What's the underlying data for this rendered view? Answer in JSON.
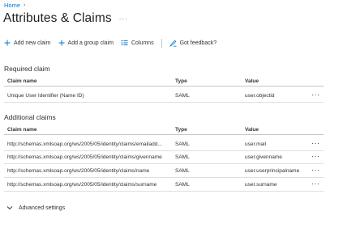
{
  "breadcrumb": {
    "home": "Home",
    "separator": "›"
  },
  "header": {
    "title": "Attributes & Claims",
    "more": "···"
  },
  "toolbar": {
    "add_new_claim": "Add new claim",
    "add_group_claim": "Add a group claim",
    "columns": "Columns",
    "feedback": "Got feedback?"
  },
  "required": {
    "heading": "Required claim",
    "columns": {
      "name": "Claim name",
      "type": "Type",
      "value": "Value"
    },
    "rows": [
      {
        "name": "Unique User Identifier (Name ID)",
        "type": "SAML",
        "value": "user.objectid",
        "more": "···"
      }
    ]
  },
  "additional": {
    "heading": "Additional claims",
    "columns": {
      "name": "Claim name",
      "type": "Type",
      "value": "Value"
    },
    "rows": [
      {
        "name": "http://schemas.xmlsoap.org/ws/2005/05/identity/claims/emailadd...",
        "type": "SAML",
        "value": "user.mail",
        "more": "···"
      },
      {
        "name": "http://schemas.xmlsoap.org/ws/2005/05/identity/claims/givenname",
        "type": "SAML",
        "value": "user.givenname",
        "more": "···"
      },
      {
        "name": "http://schemas.xmlsoap.org/ws/2005/05/identity/claims/name",
        "type": "SAML",
        "value": "user.userprincipalname",
        "more": "···"
      },
      {
        "name": "http://schemas.xmlsoap.org/ws/2005/05/identity/claims/surname",
        "type": "SAML",
        "value": "user.surname",
        "more": "···"
      }
    ]
  },
  "advanced": {
    "label": "Advanced settings"
  },
  "colors": {
    "accent": "#0078d4",
    "text": "#323130",
    "border": "#c8c6c4"
  },
  "icons": [
    "plus-icon",
    "columns-icon",
    "feedback-icon",
    "more-icon",
    "chevron-down-icon"
  ]
}
